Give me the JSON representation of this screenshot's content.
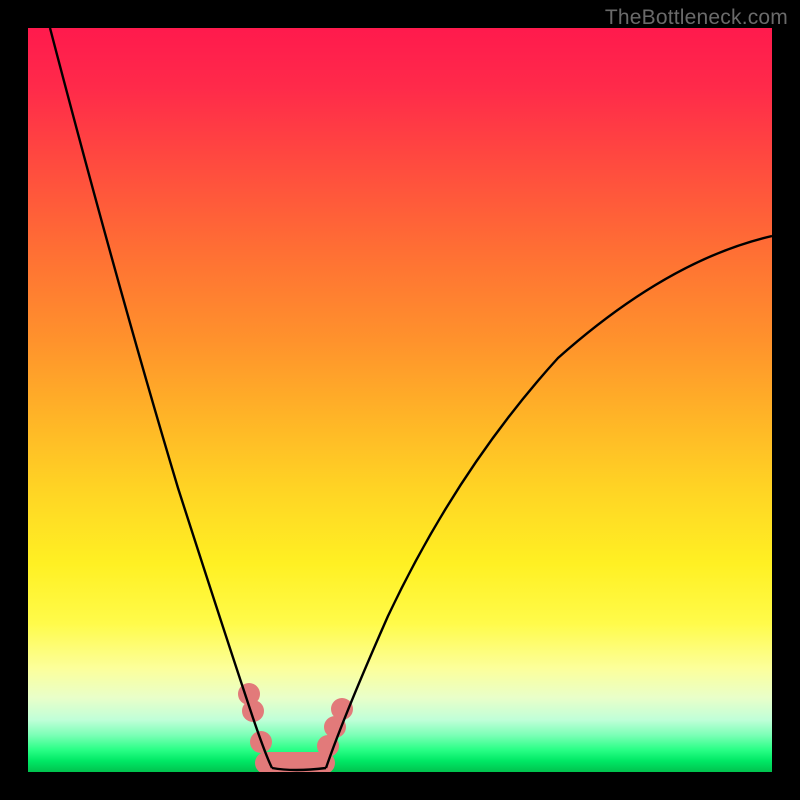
{
  "watermark": "TheBottleneck.com",
  "chart_data": {
    "type": "line",
    "title": "",
    "xlabel": "",
    "ylabel": "",
    "xlim": [
      0,
      100
    ],
    "ylim": [
      0,
      100
    ],
    "grid": false,
    "legend": false,
    "series": [
      {
        "name": "left-branch",
        "x": [
          3,
          6,
          10,
          14,
          18,
          22,
          25,
          27.5,
          29.5,
          31,
          32,
          32.8
        ],
        "y": [
          100,
          88,
          73,
          58,
          44,
          31,
          20,
          12,
          7,
          3.5,
          1.5,
          0.5
        ]
      },
      {
        "name": "right-branch",
        "x": [
          40,
          42,
          45,
          50,
          56,
          63,
          71,
          80,
          90,
          100
        ],
        "y": [
          0.5,
          3,
          8,
          17,
          28,
          39,
          49,
          58,
          66,
          72
        ]
      },
      {
        "name": "valley-floor",
        "x": [
          32.8,
          34,
          36,
          38,
          40
        ],
        "y": [
          0.5,
          0.2,
          0.2,
          0.2,
          0.5
        ]
      }
    ],
    "markers": {
      "name": "pink-markers",
      "points": [
        {
          "x": 29.7,
          "y": 10.5
        },
        {
          "x": 30.2,
          "y": 8.2
        },
        {
          "x": 31.3,
          "y": 4.0
        },
        {
          "x": 40.3,
          "y": 3.5
        },
        {
          "x": 41.3,
          "y": 6.0
        },
        {
          "x": 42.2,
          "y": 8.5
        }
      ],
      "bar": {
        "x1": 32.0,
        "x2": 39.8,
        "y": 1.2
      }
    },
    "background_gradient": {
      "top": "#ff1a4d",
      "mid": "#ffd424",
      "bottom": "#00c24e"
    }
  }
}
